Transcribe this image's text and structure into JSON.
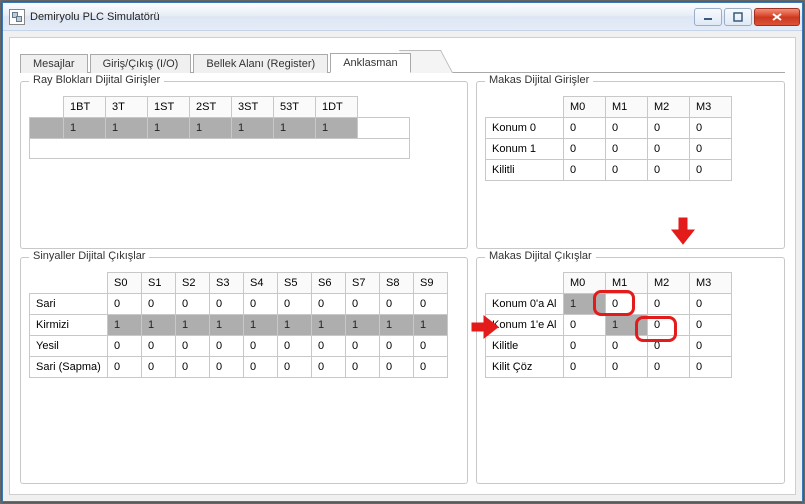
{
  "window": {
    "title": "Demiryolu PLC Simulatörü"
  },
  "tabs": {
    "t0": "Mesajlar",
    "t1": "Giriş/Çıkış (I/O)",
    "t2": "Bellek Alanı (Register)",
    "t3": "Anklasman"
  },
  "panels": {
    "ray_in": {
      "title": "Ray Blokları Dijital Girişler"
    },
    "makas_in": {
      "title": "Makas Dijital Girişler"
    },
    "sinyal_out": {
      "title": "Sinyaller Dijital Çıkışlar"
    },
    "makas_out": {
      "title": "Makas Dijital Çıkışlar"
    }
  },
  "ray_in": {
    "headers": {
      "c0": "1BT",
      "c1": "3T",
      "c2": "1ST",
      "c3": "2ST",
      "c4": "3ST",
      "c5": "53T",
      "c6": "1DT"
    },
    "row0": {
      "c0": "1",
      "c1": "1",
      "c2": "1",
      "c3": "1",
      "c4": "1",
      "c5": "1",
      "c6": "1"
    }
  },
  "makas_in": {
    "headers": {
      "m0": "M0",
      "m1": "M1",
      "m2": "M2",
      "m3": "M3"
    },
    "rows": {
      "r0": {
        "label": "Konum 0",
        "m0": "0",
        "m1": "0",
        "m2": "0",
        "m3": "0"
      },
      "r1": {
        "label": "Konum 1",
        "m0": "0",
        "m1": "0",
        "m2": "0",
        "m3": "0"
      },
      "r2": {
        "label": "Kilitli",
        "m0": "0",
        "m1": "0",
        "m2": "0",
        "m3": "0"
      }
    }
  },
  "sinyal_out": {
    "headers": {
      "s0": "S0",
      "s1": "S1",
      "s2": "S2",
      "s3": "S3",
      "s4": "S4",
      "s5": "S5",
      "s6": "S6",
      "s7": "S7",
      "s8": "S8",
      "s9": "S9"
    },
    "rows": {
      "r0": {
        "label": "Sari",
        "s0": "0",
        "s1": "0",
        "s2": "0",
        "s3": "0",
        "s4": "0",
        "s5": "0",
        "s6": "0",
        "s7": "0",
        "s8": "0",
        "s9": "0"
      },
      "r1": {
        "label": "Kirmizi",
        "s0": "1",
        "s1": "1",
        "s2": "1",
        "s3": "1",
        "s4": "1",
        "s5": "1",
        "s6": "1",
        "s7": "1",
        "s8": "1",
        "s9": "1"
      },
      "r2": {
        "label": "Yesil",
        "s0": "0",
        "s1": "0",
        "s2": "0",
        "s3": "0",
        "s4": "0",
        "s5": "0",
        "s6": "0",
        "s7": "0",
        "s8": "0",
        "s9": "0"
      },
      "r3": {
        "label": "Sari (Sapma)",
        "s0": "0",
        "s1": "0",
        "s2": "0",
        "s3": "0",
        "s4": "0",
        "s5": "0",
        "s6": "0",
        "s7": "0",
        "s8": "0",
        "s9": "0"
      }
    }
  },
  "makas_out": {
    "headers": {
      "m0": "M0",
      "m1": "M1",
      "m2": "M2",
      "m3": "M3"
    },
    "rows": {
      "r0": {
        "label": "Konum 0'a Al",
        "m0": "1",
        "m1": "0",
        "m2": "0",
        "m3": "0"
      },
      "r1": {
        "label": "Konum 1'e Al",
        "m0": "0",
        "m1": "1",
        "m2": "0",
        "m3": "0"
      },
      "r2": {
        "label": "Kilitle",
        "m0": "0",
        "m1": "0",
        "m2": "0",
        "m3": "0"
      },
      "r3": {
        "label": "Kilit Çöz",
        "m0": "0",
        "m1": "0",
        "m2": "0",
        "m3": "0"
      }
    }
  }
}
